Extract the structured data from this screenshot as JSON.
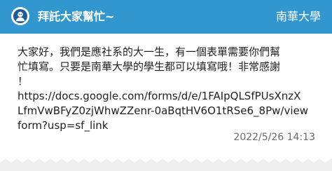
{
  "header": {
    "title": "拜託大家幫忙~",
    "board": "南華大學",
    "colors": {
      "bar": "#3397cf",
      "text": "#ffffff"
    },
    "avatar_icon": "anonymous-user-icon"
  },
  "post": {
    "lines": [
      "大家好，我們是應社系的大一生，有一個表單需要你們幫",
      "忙填寫。只要是南華大學的學生都可以填寫哦！非常感謝",
      "！",
      "https://docs.google.com/forms/d/e/1FAIpQLSfPUsXnzX",
      "LfmVwBFyZ0zjWhwZZenr-0aBqtHV6O1tRSe6_8Pw/view",
      "form?usp=sf_link"
    ],
    "timestamp": "2022/5/26 14:13"
  }
}
